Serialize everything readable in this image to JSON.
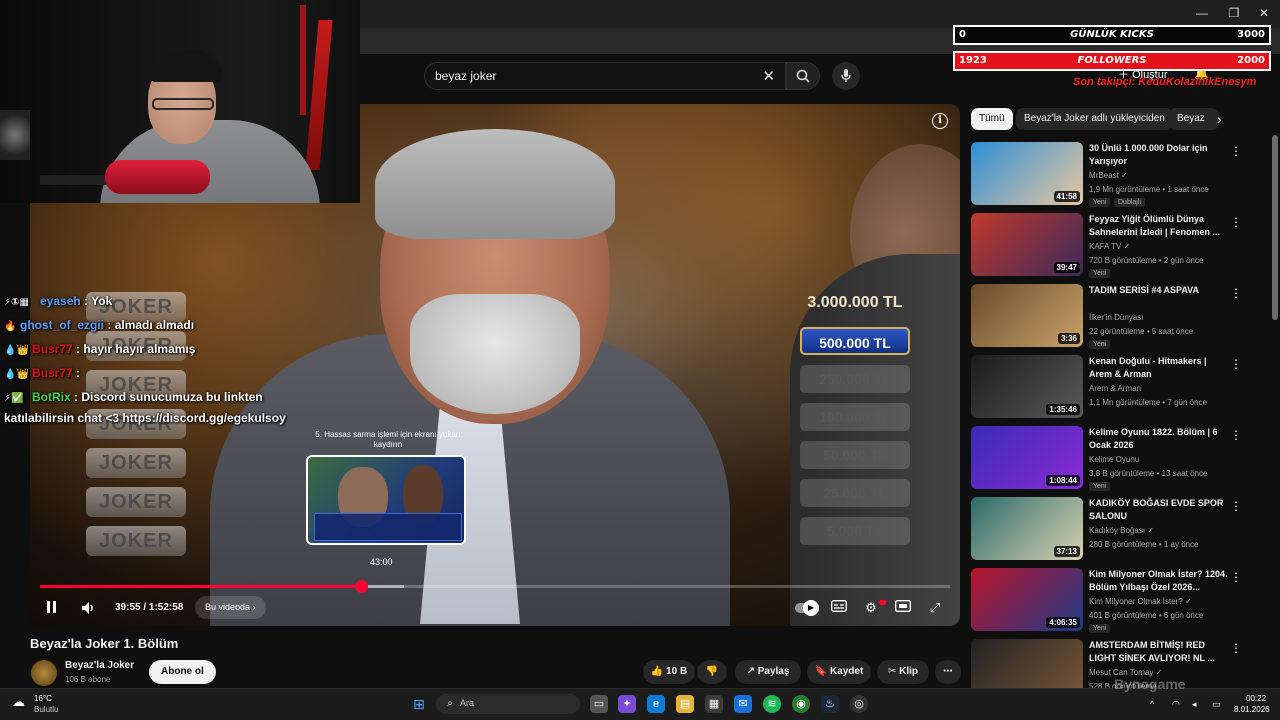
{
  "search": {
    "query": "beyaz joker"
  },
  "stream": {
    "kicks_label": "GÜNLÜK KICKS",
    "kicks_current": "0",
    "kicks_goal": "3000",
    "followers_label": "FOLLOWERS",
    "followers_current": "1923",
    "followers_goal": "2000",
    "last_follower": "Son takipçi: KeduKolazinikEnesym"
  },
  "header": {
    "create_label": "Oluştur"
  },
  "player": {
    "jokers": [
      "JOKER",
      "JOKER",
      "JOKER",
      "JOKER",
      "JOKER",
      "JOKER",
      "JOKER"
    ],
    "prizes": [
      "3.000.000 TL",
      "500.000 TL",
      "250.000 TL",
      "100.000 TL",
      "50.000 TL",
      "25.000 TL",
      "5.000 TL"
    ],
    "preview_caption": "5. Hassas sarma işlemi için ekranı yukarı kaydırın",
    "preview_time": "43:00",
    "time": "39:55 / 1:52:58",
    "chapter": "Bu videoda",
    "progress": 0.353,
    "buffered": 0.4
  },
  "chat": [
    {
      "user": "eyaseh",
      "message": ": Yok",
      "color": "#5b9cff"
    },
    {
      "user": "ghost_of_ezgii",
      "message": ": almadı almadı",
      "color": "#5b9cff"
    },
    {
      "user": "Busr77",
      "message": ": hayır hayır almamış",
      "color": "#e3111a"
    },
    {
      "user": "Busr77",
      "message": ":",
      "color": "#e3111a"
    },
    {
      "user": "BotRix",
      "message": ": Discord sunucumuza bu linkten",
      "color": "#3fd44d"
    }
  ],
  "chat_wrap": "katılabilirsin chat <3 https://discord.gg/egekulsoy",
  "video": {
    "title": "Beyaz'la Joker 1. Bölüm",
    "channel": "Beyaz'la Joker",
    "subscribers": "106 B abone",
    "subscribe": "Abone ol",
    "likes": "10 B",
    "share": "Paylaş",
    "save": "Kaydet",
    "clip": "Klip"
  },
  "chips": [
    "Tümü",
    "Beyaz'la Joker adlı yükleyiciden",
    "Beyaz"
  ],
  "recommendations": [
    {
      "title": "30 Ünlü 1.000.000 Dolar için Yarışıyor",
      "channel": "MrBeast ✓",
      "meta": "1,9 Mn görüntüleme • 1 saat önce",
      "duration": "41:58",
      "badge": "Yeni",
      "badge2": "Dublajlı",
      "c1": "#2c8fd6",
      "c2": "#e8c7a0"
    },
    {
      "title": "Feyyaz Yiğit Ölümlü Dünya Sahnelerini İzledi | Fenomen ...",
      "channel": "KAFA TV ✓",
      "meta": "720 B görüntüleme • 2 gün önce",
      "duration": "39:47",
      "badge": "Yeni",
      "badge2": "",
      "c1": "#c0392b",
      "c2": "#3b2a5a"
    },
    {
      "title": "TADIM SERİSİ #4 ASPAVA",
      "channel": "İlker'in Dünyası",
      "meta": "22 görüntüleme • 5 saat önce",
      "duration": "3:36",
      "badge": "Yeni",
      "badge2": "",
      "c1": "#6b4a2b",
      "c2": "#c9a36a"
    },
    {
      "title": "Kenan Doğulu - Hitmakers | Arem & Arman",
      "channel": "Arem & Arman",
      "meta": "1,1 Mn görüntüleme • 7 gün önce",
      "duration": "1:35:46",
      "badge": "",
      "badge2": "",
      "c1": "#1b1b1b",
      "c2": "#5a5a5a"
    },
    {
      "title": "Kelime Oyunu 1822. Bölüm | 6 Ocak 2026",
      "channel": "Kelime Oyunu",
      "meta": "3,8 B görüntüleme • 13 saat önce",
      "duration": "1:08:44",
      "badge": "Yeni",
      "badge2": "",
      "c1": "#3b2bb5",
      "c2": "#8a2bd6"
    },
    {
      "title": "KADIKÖY BOĞASI EVDE SPOR SALONU",
      "channel": "Kadıköy Boğası ✓",
      "meta": "280 B görüntüleme • 1 ay önce",
      "duration": "37:13",
      "badge": "",
      "badge2": "",
      "c1": "#2b6b6b",
      "c2": "#d9d2b0"
    },
    {
      "title": "Kim Milyoner Olmak İster? 1204. Bölüm Yılbaşı Özel 2026...",
      "channel": "Kim Milyoner Olmak İster? ✓",
      "meta": "401 B görüntüleme • 6 gün önce",
      "duration": "4:06:35",
      "badge": "Yeni",
      "badge2": "",
      "c1": "#b8142a",
      "c2": "#1e3a8a"
    },
    {
      "title": "AMSTERDAM BİTMİŞ! RED LIGHT SİNEK AVLIYOR! NL ...",
      "channel": "Mesut Can Tomay ✓",
      "meta": "528 B görüntüleme",
      "duration": "",
      "badge": "",
      "badge2": "",
      "c1": "#222",
      "c2": "#7a5a3a"
    }
  ],
  "taskbar": {
    "temp": "16°C",
    "condition": "Bulutlu",
    "search": "Ara",
    "time": "00:22",
    "date": "8.01.2026"
  },
  "watermark": "Bynogame",
  "colors": {
    "accent": "#ff0033",
    "bg": "#0f0f0f",
    "followers_bar": "#e3111a"
  }
}
